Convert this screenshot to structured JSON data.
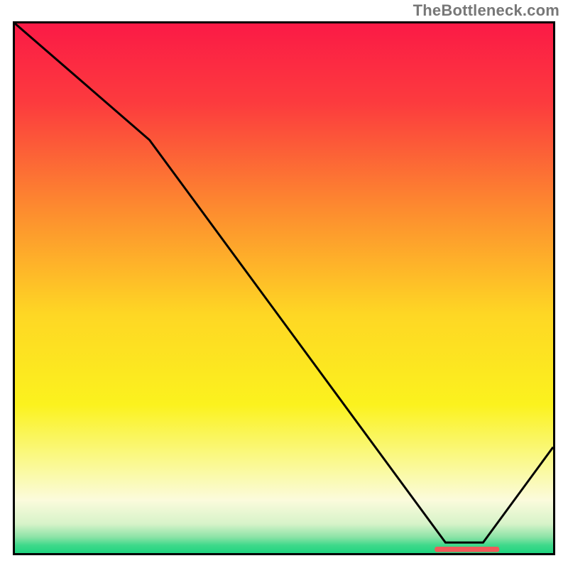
{
  "watermark": "TheBottleneck.com",
  "chart_data": {
    "type": "line",
    "title": "",
    "xlabel": "",
    "ylabel": "",
    "xlim": [
      0,
      100
    ],
    "ylim": [
      0,
      100
    ],
    "grid": false,
    "legend": false,
    "series": [
      {
        "name": "curve",
        "x": [
          0,
          25,
          80,
          87,
          100
        ],
        "y": [
          100,
          78,
          2,
          2,
          20
        ]
      }
    ],
    "marker": {
      "name": "target-segment",
      "x_range": [
        78,
        90
      ],
      "y": 0.7,
      "color": "#f15a5a"
    },
    "background": {
      "type": "vertical-gradient",
      "stops": [
        {
          "pos": 0,
          "color": "#fb1a46"
        },
        {
          "pos": 0.15,
          "color": "#fc3b3e"
        },
        {
          "pos": 0.35,
          "color": "#fd8b2f"
        },
        {
          "pos": 0.55,
          "color": "#fed724"
        },
        {
          "pos": 0.72,
          "color": "#fbf21e"
        },
        {
          "pos": 0.83,
          "color": "#faf991"
        },
        {
          "pos": 0.9,
          "color": "#fbfbdc"
        },
        {
          "pos": 0.945,
          "color": "#d7f3c9"
        },
        {
          "pos": 0.97,
          "color": "#8be3a6"
        },
        {
          "pos": 0.985,
          "color": "#3fd98b"
        },
        {
          "pos": 1.0,
          "color": "#1fd47f"
        }
      ]
    }
  }
}
